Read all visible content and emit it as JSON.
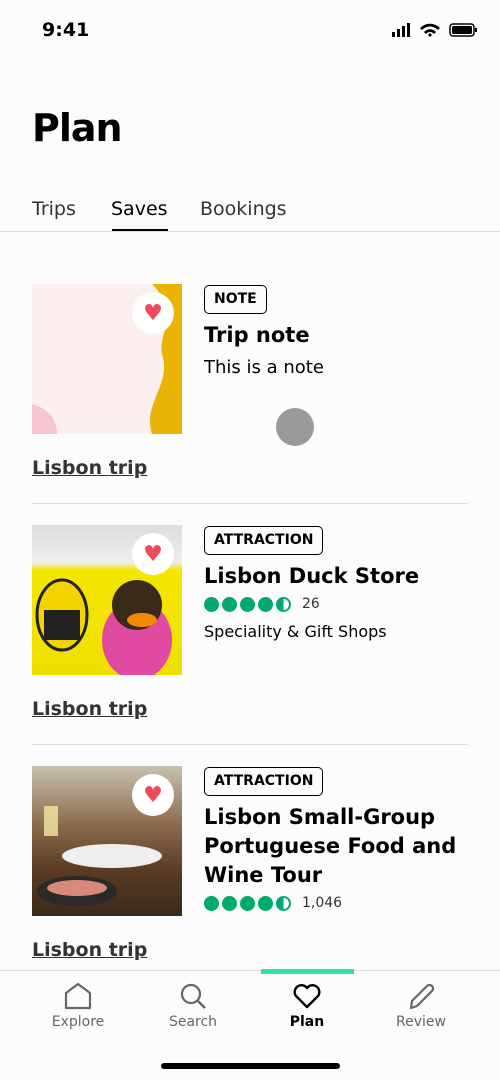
{
  "status_bar": {
    "time": "9:41"
  },
  "header": {
    "title": "Plan"
  },
  "tabs": [
    {
      "label": "Trips"
    },
    {
      "label": "Saves",
      "active": true
    },
    {
      "label": "Bookings"
    }
  ],
  "cards": [
    {
      "badge": "NOTE",
      "title": "Trip note",
      "subtitle": "This is a note",
      "trip": "Lisbon trip",
      "saved": true
    },
    {
      "badge": "ATTRACTION",
      "title": "Lisbon Duck Store",
      "rating": 4.5,
      "reviews": "26",
      "category": "Speciality & Gift Shops",
      "trip": "Lisbon trip",
      "saved": true
    },
    {
      "badge": "ATTRACTION",
      "title": "Lisbon Small-Group Portuguese Food and Wine Tour",
      "rating": 4.5,
      "reviews": "1,046",
      "trip": "Lisbon trip",
      "saved": true
    }
  ],
  "nav": [
    {
      "label": "Explore",
      "icon": "home-icon"
    },
    {
      "label": "Search",
      "icon": "search-icon"
    },
    {
      "label": "Plan",
      "icon": "heart-icon",
      "active": true
    },
    {
      "label": "Review",
      "icon": "pencil-icon"
    }
  ],
  "colors": {
    "accent": "#34e0a1",
    "rating": "#00aa6c",
    "heart": "#ef4a5a"
  }
}
